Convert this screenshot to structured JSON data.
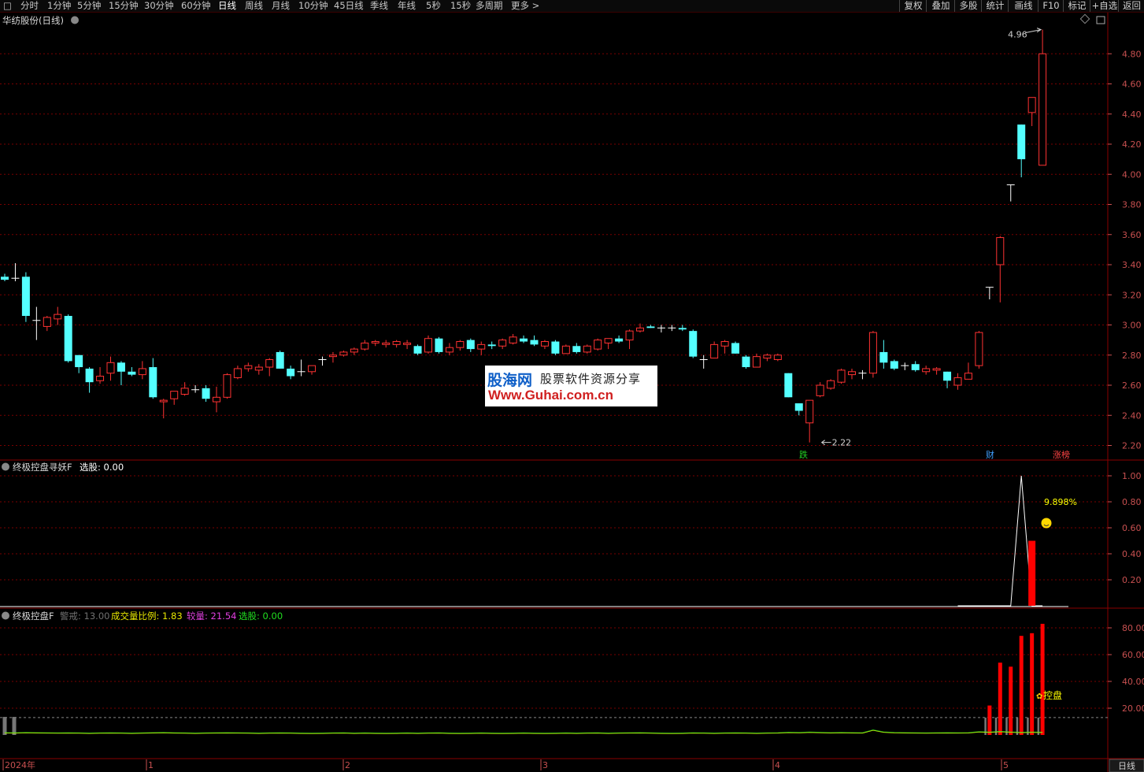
{
  "toolbar": {
    "tabs": [
      "分时",
      "1分钟",
      "5分钟",
      "15分钟",
      "30分钟",
      "60分钟",
      "日线",
      "周线",
      "月线",
      "10分钟",
      "45日线",
      "季线",
      "年线",
      "5秒",
      "15秒",
      "多周期",
      "更多 >"
    ],
    "active_tab": "日线",
    "right_buttons": [
      "复权",
      "叠加",
      "多股",
      "统计",
      "画线",
      "F10",
      "标记",
      "+自选",
      "返回"
    ]
  },
  "main_panel": {
    "title": "华纺股份(日线)",
    "high_label": "4.96",
    "low_label": "2.22",
    "markers": [
      {
        "text": "跌",
        "color": "#22cc22"
      },
      {
        "text": "财",
        "color": "#3fa0ff"
      },
      {
        "text": "涨榜",
        "color": "#ff4444"
      }
    ]
  },
  "indicator1": {
    "name": "终极控盘寻妖F",
    "field_label": "选股:",
    "field_value": "0.00",
    "annotation": "9.898%",
    "ticks": [
      "1.00",
      "0.80",
      "0.60",
      "0.40",
      "0.20"
    ]
  },
  "indicator2": {
    "name": "终极控盘F",
    "fields": [
      {
        "label": "警戒:",
        "value": "13.00",
        "color": "#707070"
      },
      {
        "label": "成交量比例:",
        "value": "1.83",
        "color": "#e8e800"
      },
      {
        "label": "较量:",
        "value": "21.54",
        "color": "#e040e0"
      },
      {
        "label": "选股:",
        "value": "0.00",
        "color": "#20dd20"
      }
    ],
    "annotation": "控盘",
    "ticks": [
      "80.00",
      "60.00",
      "40.00",
      "20.00"
    ]
  },
  "watermark": {
    "brand": "股海网",
    "slogan": "股票软件资源分享",
    "url": "Www.Guhai.com.cn"
  },
  "x_axis": {
    "labels": [
      "2024年",
      "1",
      "2",
      "3",
      "4",
      "5"
    ],
    "period_button": "日线"
  },
  "colors": {
    "up": "#ff3232",
    "down": "#54ffff",
    "grid": "#7a0000",
    "axis": "#c85050"
  },
  "chart_data": [
    {
      "type": "candlestick",
      "title": "华纺股份(日线)",
      "y_ticks": [
        4.8,
        4.6,
        4.4,
        4.2,
        4.0,
        3.8,
        3.6,
        3.4,
        3.2,
        3.0,
        2.8,
        2.6,
        2.4,
        2.2
      ],
      "ylim": [
        2.15,
        4.98
      ],
      "candles": [
        {
          "o": 3.32,
          "h": 3.34,
          "l": 3.29,
          "c": 3.3
        },
        {
          "o": 3.31,
          "h": 3.41,
          "l": 3.29,
          "c": 3.31
        },
        {
          "o": 3.32,
          "h": 3.35,
          "l": 3.02,
          "c": 3.06
        },
        {
          "o": 3.03,
          "h": 3.12,
          "l": 2.9,
          "c": 3.03
        },
        {
          "o": 2.99,
          "h": 3.06,
          "l": 2.96,
          "c": 3.05
        },
        {
          "o": 3.04,
          "h": 3.12,
          "l": 3.0,
          "c": 3.07
        },
        {
          "o": 3.06,
          "h": 3.07,
          "l": 2.75,
          "c": 2.76
        },
        {
          "o": 2.8,
          "h": 2.8,
          "l": 2.68,
          "c": 2.72
        },
        {
          "o": 2.71,
          "h": 2.72,
          "l": 2.55,
          "c": 2.62
        },
        {
          "o": 2.63,
          "h": 2.72,
          "l": 2.61,
          "c": 2.66
        },
        {
          "o": 2.68,
          "h": 2.79,
          "l": 2.63,
          "c": 2.75
        },
        {
          "o": 2.75,
          "h": 2.76,
          "l": 2.6,
          "c": 2.69
        },
        {
          "o": 2.69,
          "h": 2.72,
          "l": 2.66,
          "c": 2.67
        },
        {
          "o": 2.67,
          "h": 2.76,
          "l": 2.64,
          "c": 2.71
        },
        {
          "o": 2.72,
          "h": 2.78,
          "l": 2.51,
          "c": 2.52
        },
        {
          "o": 2.49,
          "h": 2.51,
          "l": 2.38,
          "c": 2.5
        },
        {
          "o": 2.51,
          "h": 2.56,
          "l": 2.47,
          "c": 2.56
        },
        {
          "o": 2.54,
          "h": 2.62,
          "l": 2.53,
          "c": 2.58
        },
        {
          "o": 2.57,
          "h": 2.6,
          "l": 2.55,
          "c": 2.57
        },
        {
          "o": 2.58,
          "h": 2.6,
          "l": 2.49,
          "c": 2.51
        },
        {
          "o": 2.49,
          "h": 2.59,
          "l": 2.42,
          "c": 2.52
        },
        {
          "o": 2.52,
          "h": 2.68,
          "l": 2.51,
          "c": 2.67
        },
        {
          "o": 2.65,
          "h": 2.73,
          "l": 2.64,
          "c": 2.71
        },
        {
          "o": 2.71,
          "h": 2.75,
          "l": 2.69,
          "c": 2.73
        },
        {
          "o": 2.7,
          "h": 2.74,
          "l": 2.67,
          "c": 2.72
        },
        {
          "o": 2.72,
          "h": 2.78,
          "l": 2.66,
          "c": 2.77
        },
        {
          "o": 2.82,
          "h": 2.83,
          "l": 2.71,
          "c": 2.71
        },
        {
          "o": 2.71,
          "h": 2.73,
          "l": 2.64,
          "c": 2.66
        },
        {
          "o": 2.69,
          "h": 2.77,
          "l": 2.66,
          "c": 2.69
        },
        {
          "o": 2.69,
          "h": 2.73,
          "l": 2.67,
          "c": 2.73
        },
        {
          "o": 2.77,
          "h": 2.79,
          "l": 2.73,
          "c": 2.77
        },
        {
          "o": 2.79,
          "h": 2.82,
          "l": 2.75,
          "c": 2.8
        },
        {
          "o": 2.8,
          "h": 2.83,
          "l": 2.79,
          "c": 2.82
        },
        {
          "o": 2.82,
          "h": 2.85,
          "l": 2.8,
          "c": 2.84
        },
        {
          "o": 2.84,
          "h": 2.9,
          "l": 2.83,
          "c": 2.88
        },
        {
          "o": 2.88,
          "h": 2.9,
          "l": 2.86,
          "c": 2.89
        },
        {
          "o": 2.87,
          "h": 2.9,
          "l": 2.85,
          "c": 2.88
        },
        {
          "o": 2.87,
          "h": 2.9,
          "l": 2.85,
          "c": 2.89
        },
        {
          "o": 2.87,
          "h": 2.9,
          "l": 2.84,
          "c": 2.88
        },
        {
          "o": 2.86,
          "h": 2.87,
          "l": 2.8,
          "c": 2.81
        },
        {
          "o": 2.82,
          "h": 2.93,
          "l": 2.81,
          "c": 2.91
        },
        {
          "o": 2.91,
          "h": 2.92,
          "l": 2.81,
          "c": 2.82
        },
        {
          "o": 2.82,
          "h": 2.88,
          "l": 2.8,
          "c": 2.85
        },
        {
          "o": 2.85,
          "h": 2.9,
          "l": 2.83,
          "c": 2.89
        },
        {
          "o": 2.9,
          "h": 2.91,
          "l": 2.82,
          "c": 2.84
        },
        {
          "o": 2.84,
          "h": 2.89,
          "l": 2.8,
          "c": 2.87
        },
        {
          "o": 2.87,
          "h": 2.89,
          "l": 2.84,
          "c": 2.86
        },
        {
          "o": 2.86,
          "h": 2.91,
          "l": 2.84,
          "c": 2.9
        },
        {
          "o": 2.88,
          "h": 2.94,
          "l": 2.87,
          "c": 2.92
        },
        {
          "o": 2.91,
          "h": 2.93,
          "l": 2.88,
          "c": 2.89
        },
        {
          "o": 2.9,
          "h": 2.93,
          "l": 2.86,
          "c": 2.87
        },
        {
          "o": 2.86,
          "h": 2.9,
          "l": 2.84,
          "c": 2.89
        },
        {
          "o": 2.89,
          "h": 2.9,
          "l": 2.8,
          "c": 2.81
        },
        {
          "o": 2.81,
          "h": 2.87,
          "l": 2.81,
          "c": 2.86
        },
        {
          "o": 2.86,
          "h": 2.88,
          "l": 2.81,
          "c": 2.82
        },
        {
          "o": 2.82,
          "h": 2.87,
          "l": 2.81,
          "c": 2.86
        },
        {
          "o": 2.84,
          "h": 2.91,
          "l": 2.83,
          "c": 2.9
        },
        {
          "o": 2.88,
          "h": 2.91,
          "l": 2.84,
          "c": 2.91
        },
        {
          "o": 2.91,
          "h": 2.93,
          "l": 2.88,
          "c": 2.89
        },
        {
          "o": 2.9,
          "h": 2.97,
          "l": 2.84,
          "c": 2.96
        },
        {
          "o": 2.96,
          "h": 3.01,
          "l": 2.95,
          "c": 2.98
        },
        {
          "o": 2.99,
          "h": 3.0,
          "l": 2.98,
          "c": 2.98
        },
        {
          "o": 2.98,
          "h": 3.0,
          "l": 2.95,
          "c": 2.98
        },
        {
          "o": 2.98,
          "h": 3.0,
          "l": 2.96,
          "c": 2.98
        },
        {
          "o": 2.98,
          "h": 3.0,
          "l": 2.96,
          "c": 2.97
        },
        {
          "o": 2.96,
          "h": 2.97,
          "l": 2.78,
          "c": 2.79
        },
        {
          "o": 2.77,
          "h": 2.8,
          "l": 2.71,
          "c": 2.77
        },
        {
          "o": 2.78,
          "h": 2.89,
          "l": 2.78,
          "c": 2.87
        },
        {
          "o": 2.86,
          "h": 2.9,
          "l": 2.81,
          "c": 2.89
        },
        {
          "o": 2.88,
          "h": 2.89,
          "l": 2.81,
          "c": 2.81
        },
        {
          "o": 2.79,
          "h": 2.8,
          "l": 2.71,
          "c": 2.72
        },
        {
          "o": 2.72,
          "h": 2.81,
          "l": 2.72,
          "c": 2.79
        },
        {
          "o": 2.78,
          "h": 2.81,
          "l": 2.76,
          "c": 2.8
        },
        {
          "o": 2.77,
          "h": 2.81,
          "l": 2.76,
          "c": 2.8
        },
        {
          "o": 2.68,
          "h": 2.68,
          "l": 2.52,
          "c": 2.52
        },
        {
          "o": 2.48,
          "h": 2.48,
          "l": 2.4,
          "c": 2.43
        },
        {
          "o": 2.35,
          "h": 2.49,
          "l": 2.22,
          "c": 2.5
        },
        {
          "o": 2.53,
          "h": 2.62,
          "l": 2.52,
          "c": 2.6
        },
        {
          "o": 2.58,
          "h": 2.64,
          "l": 2.57,
          "c": 2.63
        },
        {
          "o": 2.62,
          "h": 2.71,
          "l": 2.61,
          "c": 2.7
        },
        {
          "o": 2.67,
          "h": 2.71,
          "l": 2.64,
          "c": 2.69
        },
        {
          "o": 2.68,
          "h": 2.7,
          "l": 2.64,
          "c": 2.68
        },
        {
          "o": 2.68,
          "h": 2.96,
          "l": 2.65,
          "c": 2.95
        },
        {
          "o": 2.82,
          "h": 2.9,
          "l": 2.71,
          "c": 2.75
        },
        {
          "o": 2.76,
          "h": 2.77,
          "l": 2.7,
          "c": 2.71
        },
        {
          "o": 2.73,
          "h": 2.75,
          "l": 2.7,
          "c": 2.73
        },
        {
          "o": 2.74,
          "h": 2.76,
          "l": 2.69,
          "c": 2.7
        },
        {
          "o": 2.69,
          "h": 2.73,
          "l": 2.67,
          "c": 2.71
        },
        {
          "o": 2.7,
          "h": 2.72,
          "l": 2.67,
          "c": 2.71
        },
        {
          "o": 2.69,
          "h": 2.69,
          "l": 2.58,
          "c": 2.63
        },
        {
          "o": 2.6,
          "h": 2.68,
          "l": 2.57,
          "c": 2.65
        },
        {
          "o": 2.64,
          "h": 2.75,
          "l": 2.64,
          "c": 2.68
        },
        {
          "o": 2.73,
          "h": 2.96,
          "l": 2.71,
          "c": 2.95
        },
        {
          "o": 3.25,
          "h": 3.25,
          "l": 3.17,
          "c": 3.25
        },
        {
          "o": 3.4,
          "h": 3.59,
          "l": 3.15,
          "c": 3.58
        },
        {
          "o": 3.93,
          "h": 3.93,
          "l": 3.82,
          "c": 3.93
        },
        {
          "o": 4.33,
          "h": 4.33,
          "l": 3.98,
          "c": 4.1
        },
        {
          "o": 4.41,
          "h": 4.51,
          "l": 4.32,
          "c": 4.51
        },
        {
          "o": 4.06,
          "h": 4.96,
          "l": 4.06,
          "c": 4.8
        }
      ]
    },
    {
      "type": "line",
      "title": "终极控盘寻妖F",
      "ylim": [
        0,
        1.0
      ],
      "signal_line": [
        0,
        0,
        0,
        0,
        0,
        0,
        1,
        0,
        0
      ],
      "bar_values": [
        0,
        0,
        0,
        0,
        0,
        0,
        0,
        0.5,
        0
      ]
    },
    {
      "type": "bar",
      "title": "终极控盘F",
      "ylim": [
        0,
        85
      ],
      "warning_level": 13.0,
      "volume_ratio": [
        1.5,
        1.4,
        1.6,
        1.5,
        1.4,
        1.3,
        1.4,
        1.3,
        1.2,
        1.3,
        1.4,
        1.3,
        1.2,
        1.3,
        1.5,
        1.6,
        1.4,
        1.3,
        1.2,
        1.3,
        1.4,
        1.5,
        1.4,
        1.3,
        1.2,
        1.3,
        1.4,
        1.3,
        1.2,
        1.1,
        1.2,
        1.3,
        1.4,
        1.2,
        1.3,
        1.2,
        1.1,
        1.2,
        1.3,
        1.2,
        1.3,
        1.4,
        1.2,
        1.1,
        1.2,
        1.3,
        1.2,
        1.1,
        1.2,
        1.3,
        1.2,
        1.1,
        1.2,
        1.3,
        1.2,
        1.3,
        1.4,
        1.2,
        1.3,
        1.4,
        1.5,
        1.3,
        1.2,
        1.1,
        1.2,
        1.4,
        1.3,
        1.2,
        1.3,
        1.4,
        1.3,
        1.2,
        1.3,
        1.4,
        1.8,
        1.6,
        1.9,
        1.7,
        1.5,
        1.6,
        1.5,
        1.4,
        3.5,
        2.0,
        1.6,
        1.5,
        1.4,
        1.3,
        1.4,
        1.5,
        1.4,
        1.5,
        2.2,
        1.9,
        2.4,
        2.0,
        1.8,
        1.9,
        1.83
      ],
      "bars": [
        {
          "idx": 0,
          "value": 13.5,
          "color": "gray"
        },
        {
          "idx": 1,
          "value": 13.5,
          "color": "gray"
        },
        {
          "idx": 93,
          "value": 22.0,
          "color": "red"
        },
        {
          "idx": 94,
          "value": 54.0,
          "color": "red"
        },
        {
          "idx": 95,
          "value": 51.0,
          "color": "red"
        },
        {
          "idx": 96,
          "value": 74.0,
          "color": "red"
        },
        {
          "idx": 97,
          "value": 76.0,
          "color": "red"
        },
        {
          "idx": 98,
          "value": 83.0,
          "color": "red"
        }
      ]
    }
  ]
}
